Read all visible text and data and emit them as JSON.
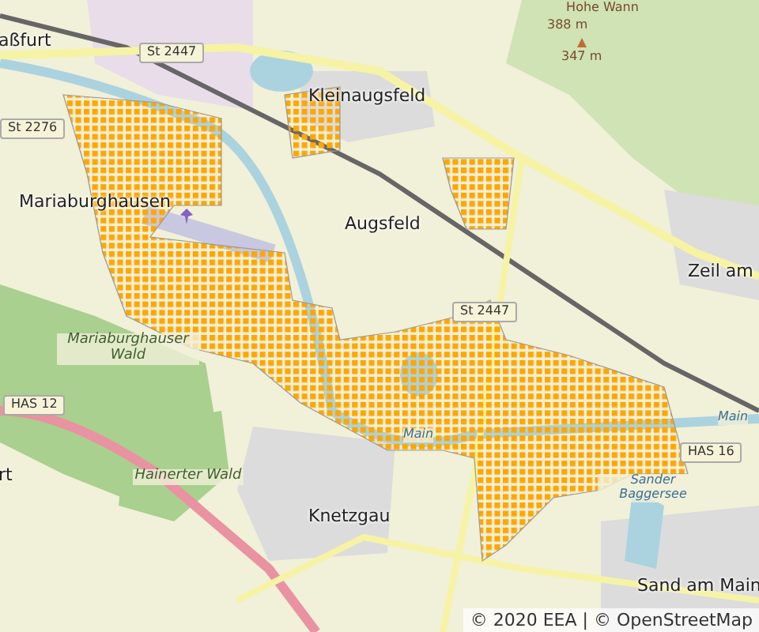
{
  "map": {
    "labels": [
      {
        "text": "aßfurt",
        "kind": "place"
      },
      {
        "text": "St 2447",
        "kind": "shield"
      },
      {
        "text": "Hohe Wann",
        "kind": "peak"
      },
      {
        "text": "388 m",
        "kind": "peak"
      },
      {
        "text": "347 m",
        "kind": "peak"
      },
      {
        "text": "Kleinaugsfeld",
        "kind": "place"
      },
      {
        "text": "St 2276",
        "kind": "shield"
      },
      {
        "text": "Mariaburghausen",
        "kind": "place"
      },
      {
        "text": "Augsfeld",
        "kind": "place"
      },
      {
        "text": "Zeil am",
        "kind": "place"
      },
      {
        "text": "St 2447",
        "kind": "shield"
      },
      {
        "text": "Mariaburghauser Wald",
        "kind": "forest"
      },
      {
        "text": "HAS 12",
        "kind": "shield"
      },
      {
        "text": "Main",
        "kind": "water"
      },
      {
        "text": "Main",
        "kind": "water"
      },
      {
        "text": "HAS 16",
        "kind": "shield"
      },
      {
        "text": "Hainerter Wald",
        "kind": "forest"
      },
      {
        "text": "Sander Baggersee",
        "kind": "water"
      },
      {
        "text": "rt",
        "kind": "place"
      },
      {
        "text": "Knetzgau",
        "kind": "place"
      },
      {
        "text": "Sand am Main",
        "kind": "place"
      }
    ],
    "attribution": "© 2020 EEA | © OpenStreetMap"
  }
}
